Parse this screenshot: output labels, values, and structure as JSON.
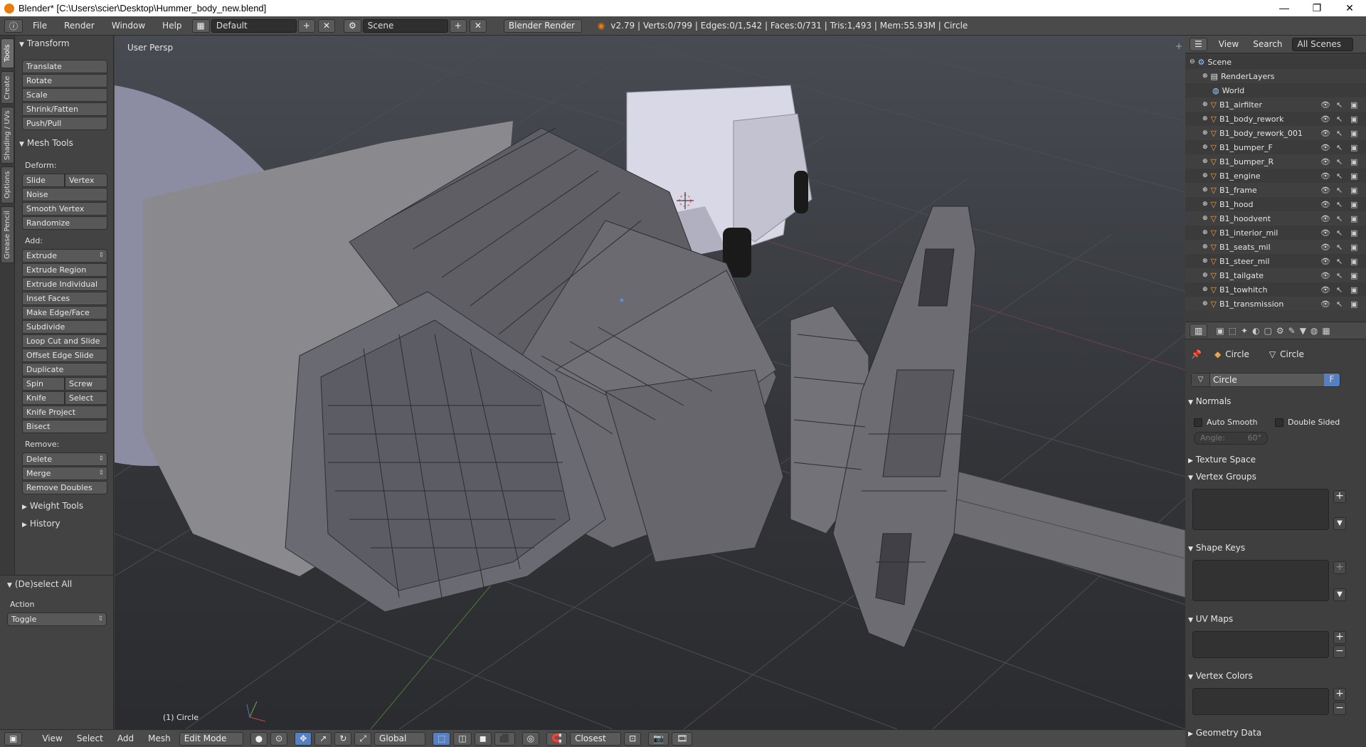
{
  "window": {
    "title": "Blender* [C:\\Users\\scier\\Desktop\\Hummer_body_new.blend]",
    "controls": [
      "—",
      "❐",
      "✕"
    ]
  },
  "info_header": {
    "menus": [
      "File",
      "Render",
      "Window",
      "Help"
    ],
    "layout": "Default",
    "scene": "Scene",
    "engine": "Blender Render",
    "stats": "v2.79 | Verts:0/799 | Edges:0/1,542 | Faces:0/731 | Tris:1,493 | Mem:55.93M | Circle"
  },
  "tabs": [
    "Tools",
    "Create",
    "Shading / UVs",
    "Options",
    "Grease Pencil"
  ],
  "toolshelf": {
    "transform": {
      "title": "Transform",
      "buttons": [
        "Translate",
        "Rotate",
        "Scale",
        "Shrink/Fatten",
        "Push/Pull"
      ]
    },
    "mesh_tools": {
      "title": "Mesh Tools",
      "deform_label": "Deform:",
      "slide_edge": "Slide Edge",
      "vertex": "Vertex",
      "deform": [
        "Noise",
        "Smooth Vertex",
        "Randomize"
      ],
      "add_label": "Add:",
      "extrude": "Extrude",
      "add": [
        "Extrude Region",
        "Extrude Individual",
        "Inset Faces",
        "Make Edge/Face",
        "Subdivide",
        "Loop Cut and Slide",
        "Offset Edge Slide",
        "Duplicate"
      ],
      "spin": "Spin",
      "screw": "Screw",
      "knife": "Knife",
      "select": "Select",
      "knife_project": "Knife Project",
      "bisect": "Bisect",
      "remove_label": "Remove:",
      "delete": "Delete",
      "merge": "Merge",
      "remove_doubles": "Remove Doubles"
    },
    "weight_tools": "Weight Tools",
    "history": "History"
  },
  "operator": {
    "title": "(De)select All",
    "action_label": "Action",
    "action_value": "Toggle"
  },
  "viewport": {
    "view_name": "User Persp",
    "object_label": "(1) Circle"
  },
  "bottom_bar": {
    "menus": [
      "View",
      "Select",
      "Add",
      "Mesh"
    ],
    "mode": "Edit Mode",
    "orientation": "Global",
    "snap": "Closest"
  },
  "outliner": {
    "menus": [
      "View",
      "Search"
    ],
    "filter": "All Scenes",
    "scene": "Scene",
    "render_layers": "RenderLayers",
    "world": "World",
    "objects": [
      "B1_airfilter",
      "B1_body_rework",
      "B1_body_rework_001",
      "B1_bumper_F",
      "B1_bumper_R",
      "B1_engine",
      "B1_frame",
      "B1_hood",
      "B1_hoodvent",
      "B1_interior_mil",
      "B1_seats_mil",
      "B1_steer_mil",
      "B1_tailgate",
      "B1_towhitch",
      "B1_transmission"
    ]
  },
  "properties": {
    "object_name": "Circle",
    "mesh_name": "Circle",
    "data_field": "Circle",
    "fake_user": "F",
    "normals": {
      "title": "Normals",
      "auto_smooth": "Auto Smooth",
      "double_sided": "Double Sided",
      "angle": "Angle:",
      "angle_value": "60°"
    },
    "texture_space": "Texture Space",
    "vertex_groups": "Vertex Groups",
    "shape_keys": "Shape Keys",
    "uv_maps": "UV Maps",
    "vertex_colors": "Vertex Colors",
    "geometry_data": "Geometry Data"
  }
}
